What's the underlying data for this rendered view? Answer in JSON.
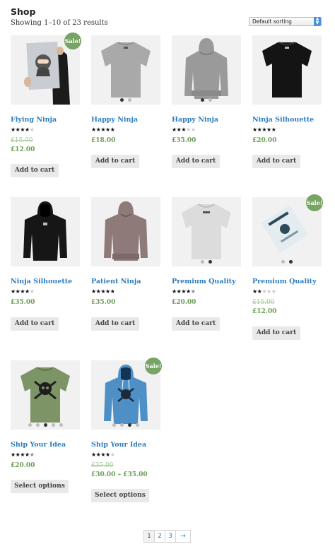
{
  "page": {
    "title": "Shop",
    "results_text": "Showing 1–10 of 23 results"
  },
  "sorting": {
    "selected": "Default sorting"
  },
  "sale_label": "Sale!",
  "products": [
    {
      "name": "Flying Ninja",
      "rating": 4,
      "old_price": "£15.00",
      "price": "£12.00",
      "button": "Add to cart",
      "sale": true,
      "image": "poster-ninja"
    },
    {
      "name": "Happy Ninja",
      "rating": 5,
      "price": "£18.00",
      "button": "Add to cart",
      "image": "grey-tshirt-back"
    },
    {
      "name": "Happy Ninja",
      "rating": 3,
      "price": "£35.00",
      "button": "Add to cart",
      "image": "grey-hoodie-back"
    },
    {
      "name": "Ninja Silhouette",
      "rating": 5,
      "price": "£20.00",
      "button": "Add to cart",
      "image": "black-tshirt"
    },
    {
      "name": "Ninja Silhouette",
      "rating": 4,
      "price": "£35.00",
      "button": "Add to cart",
      "image": "black-hoodie"
    },
    {
      "name": "Patient Ninja",
      "rating": 5,
      "price": "£35.00",
      "button": "Add to cart",
      "image": "mauve-hoodie"
    },
    {
      "name": "Premium Quality",
      "rating": 4.5,
      "price": "£20.00",
      "button": "Add to cart",
      "image": "white-tshirt"
    },
    {
      "name": "Premium Quality",
      "rating": 2,
      "old_price": "£15.00",
      "price": "£12.00",
      "button": "Add to cart",
      "sale": true,
      "image": "poster-print"
    },
    {
      "name": "Ship Your Idea",
      "rating": 4.5,
      "price": "£20.00",
      "button": "Select options",
      "image": "green-tshirt"
    },
    {
      "name": "Ship Your Idea",
      "rating": 4,
      "old_price": "£35.00",
      "price": "£30.00 – £35.00",
      "button": "Select options",
      "sale": true,
      "image": "blue-hoodie"
    }
  ],
  "pagination": {
    "pages": [
      "1",
      "2",
      "3"
    ],
    "current": "1",
    "next": "→"
  }
}
